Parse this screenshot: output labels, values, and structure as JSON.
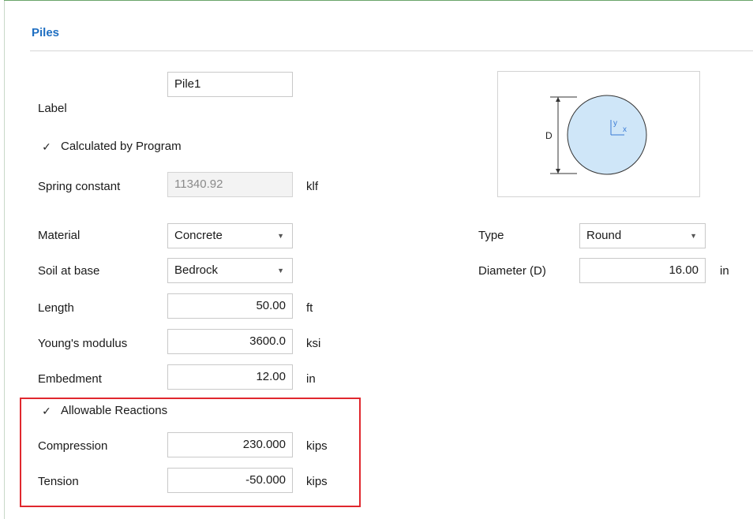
{
  "section": {
    "title": "Piles"
  },
  "fields": {
    "label": {
      "label": "Label",
      "value": "Pile1"
    },
    "calculated": {
      "label": "Calculated by Program",
      "checked": true
    },
    "spring": {
      "label": "Spring constant",
      "value": "11340.92",
      "unit": "klf"
    },
    "material": {
      "label": "Material",
      "value": "Concrete"
    },
    "soil": {
      "label": "Soil at base",
      "value": "Bedrock"
    },
    "length": {
      "label": "Length",
      "value": "50.00",
      "unit": "ft"
    },
    "youngs": {
      "label": "Young's modulus",
      "value": "3600.0",
      "unit": "ksi"
    },
    "embedment": {
      "label": "Embedment",
      "value": "12.00",
      "unit": "in"
    },
    "type": {
      "label": "Type",
      "value": "Round"
    },
    "diameter": {
      "label": "Diameter (D)",
      "value": "16.00",
      "unit": "in"
    }
  },
  "allowable": {
    "label": "Allowable Reactions",
    "checked": true,
    "compression": {
      "label": "Compression",
      "value": "230.000",
      "unit": "kips"
    },
    "tension": {
      "label": "Tension",
      "value": "-50.000",
      "unit": "kips"
    }
  },
  "diagram": {
    "dim_label": "D",
    "axis_y": "y",
    "axis_x": "x"
  },
  "colors": {
    "accent": "#1f6fc2",
    "highlight": "#e0282e",
    "circle_fill": "#cfe6f8"
  },
  "icons": {
    "check": "checkmark-icon",
    "dropdown": "chevron-down-icon"
  }
}
